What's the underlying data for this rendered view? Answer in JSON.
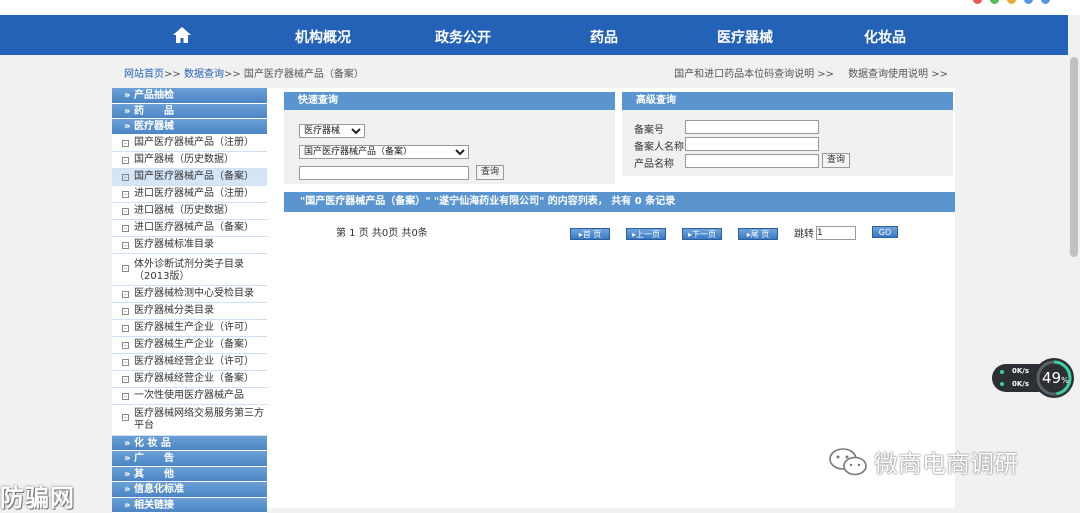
{
  "nav": {
    "items": [
      "机构概况",
      "政务公开",
      "药品",
      "医疗器械",
      "化妆品"
    ]
  },
  "breadcrumb": {
    "home": "网站首页",
    "sep1": ">>",
    "query": "数据查询",
    "sep2": ">>",
    "current": "国产医疗器械产品（备案）"
  },
  "top_links": {
    "link1": "国产和进口药品本位码查询说明 >>",
    "link2": "数据查询使用说明 >>"
  },
  "sidebar": {
    "group_chanpin": "» 产品抽检",
    "group_yaopin": "» 药　　品",
    "group_qixie": "» 医疗器械",
    "items": [
      "国产医疗器械产品（注册）",
      "国产器械（历史数据）",
      "国产医疗器械产品（备案）",
      "进口医疗器械产品（注册）",
      "进口器械（历史数据）",
      "进口医疗器械产品（备案）",
      "医疗器械标准目录",
      "体外诊断试剂分类子目录（2013版）",
      "医疗器械检测中心受检目录",
      "医疗器械分类目录",
      "医疗器械生产企业（许可）",
      "医疗器械生产企业（备案）",
      "医疗器械经营企业（许可）",
      "医疗器械经营企业（备案）",
      "一次性使用医疗器械产品",
      "医疗器械网络交易服务第三方平台"
    ],
    "group_huazhuang": "» 化 妆 品",
    "group_guanggao": "» 广　　告",
    "group_qita": "» 其　　他",
    "group_xinxi": "» 信息化标准",
    "group_lianjie": "» 相关链接"
  },
  "quick_search": {
    "title": "快速查询",
    "category_selected": "医疗器械",
    "subcategory_selected": "国产医疗器械产品（备案）",
    "keyword_value": "",
    "button": "查询"
  },
  "advanced_search": {
    "title": "高级查询",
    "label_no": "备案号",
    "label_person": "备案人名称",
    "label_product": "产品名称",
    "button": "查询"
  },
  "results": {
    "header": "\"国产医疗器械产品（备案）\" \"遂宁仙海药业有限公司\" 的内容列表，  共有 0 条记录"
  },
  "pager": {
    "info": "第 1 页 共0页 共0条",
    "first": "▸首 页",
    "prev": "▸上一页",
    "next": "▸下一页",
    "last": "▸尾 页",
    "jump_label": "跳转",
    "jump_value": "1",
    "go": "GO"
  },
  "widget": {
    "up_speed": "0K/s",
    "down_speed": "0K/s",
    "percent": "49",
    "percent_unit": "%"
  },
  "watermark": {
    "right": "微商电商调研",
    "left": "防骗网"
  },
  "colors": {
    "nav": "#2462b7",
    "sidebar_group": "#4b85c4",
    "panel_header": "#5a95d0",
    "page_bg": "#f1f1f1"
  }
}
